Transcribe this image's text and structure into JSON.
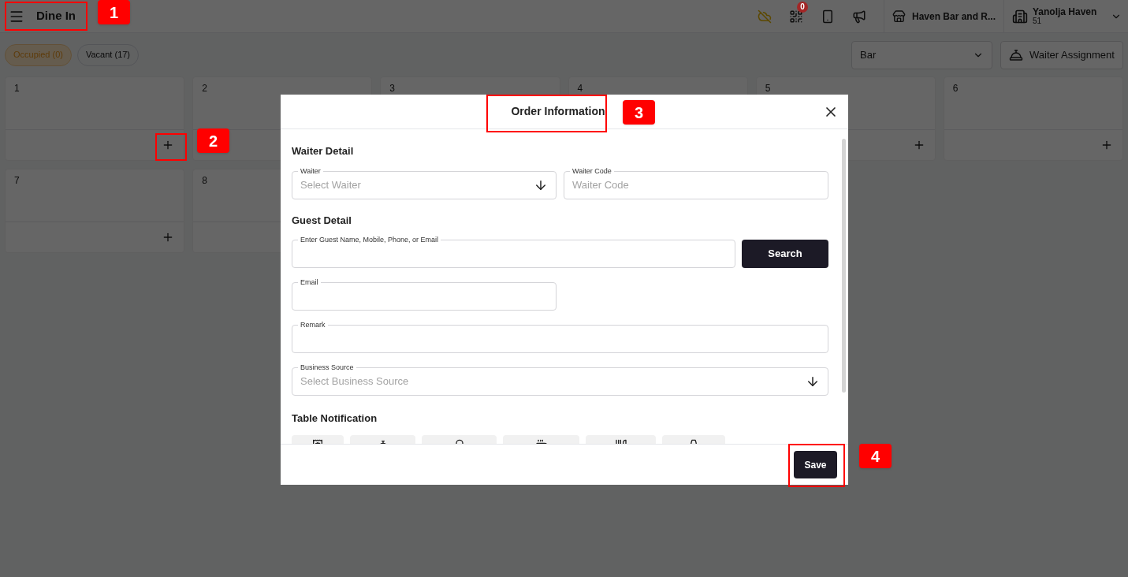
{
  "header": {
    "title": "Dine In",
    "qr_badge": "0",
    "outlet": "Haven Bar and R...",
    "property_name": "Yanolja Haven",
    "property_code": "51"
  },
  "filters": [
    {
      "label": "Occupied (0)",
      "kind": "occupied"
    },
    {
      "label": "Vacant (17)",
      "kind": "vacant"
    }
  ],
  "area_select": {
    "value": "Bar"
  },
  "waiter_assignment": "Waiter Assignment",
  "tables": [
    {
      "number": "1"
    },
    {
      "number": "2"
    },
    {
      "number": "3"
    },
    {
      "number": "4"
    },
    {
      "number": "5"
    },
    {
      "number": "6"
    },
    {
      "number": "7"
    },
    {
      "number": "8"
    }
  ],
  "modal": {
    "title": "Order Information",
    "waiter_section": "Waiter Detail",
    "waiter": {
      "label": "Waiter",
      "placeholder": "Select Waiter"
    },
    "waiter_code": {
      "label": "Waiter Code",
      "placeholder": "Waiter Code"
    },
    "guest_section": "Guest Detail",
    "guest_search": {
      "label": "Enter Guest Name, Mobile, Phone, or Email"
    },
    "search_button": "Search",
    "email": {
      "label": "Email"
    },
    "remark": {
      "label": "Remark"
    },
    "business_source": {
      "label": "Business Source",
      "placeholder": "Select Business Source"
    },
    "notification_section": "Table Notification",
    "save_button": "Save"
  },
  "annotations": [
    {
      "label": "1"
    },
    {
      "label": "2"
    },
    {
      "label": "3"
    },
    {
      "label": "4"
    }
  ]
}
